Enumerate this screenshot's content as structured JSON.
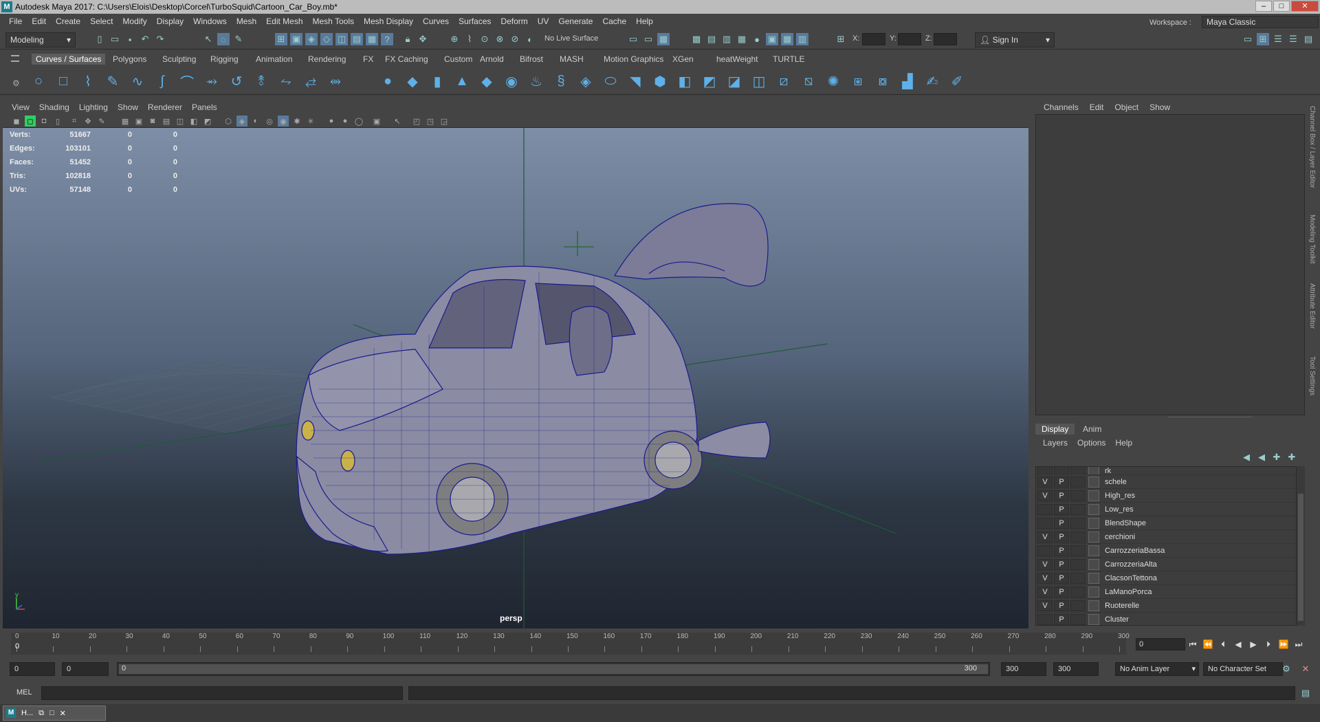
{
  "window": {
    "title": "Autodesk Maya 2017: C:\\Users\\Elois\\Desktop\\Corcel\\TurboSquid\\Cartoon_Car_Boy.mb*"
  },
  "menubar": [
    "File",
    "Edit",
    "Create",
    "Select",
    "Modify",
    "Display",
    "Windows",
    "Mesh",
    "Edit Mesh",
    "Mesh Tools",
    "Mesh Display",
    "Curves",
    "Surfaces",
    "Deform",
    "UV",
    "Generate",
    "Cache",
    "Help"
  ],
  "statusline": {
    "mode": "Modeling",
    "live_surface": "No Live Surface",
    "x_label": "X:",
    "y_label": "Y:",
    "z_label": "Z:",
    "sign_in": "Sign In",
    "workspace_label": "Workspace :",
    "workspace_value": "Maya Classic"
  },
  "shelf": {
    "tabs": [
      "Curves / Surfaces",
      "Polygons",
      "Sculpting",
      "Rigging",
      "Animation",
      "Rendering",
      "FX",
      "FX Caching",
      "Custom",
      "Arnold",
      "Bifrost",
      "MASH",
      "Motion Graphics",
      "XGen",
      "heatWeight",
      "TURTLE"
    ],
    "active_tab": "Curves / Surfaces"
  },
  "viewport": {
    "menu": [
      "View",
      "Shading",
      "Lighting",
      "Show",
      "Renderer",
      "Panels"
    ],
    "camera": "persp",
    "axis_y": "y",
    "hud": [
      [
        "Verts:",
        "51667",
        "0",
        "0"
      ],
      [
        "Edges:",
        "103101",
        "0",
        "0"
      ],
      [
        "Faces:",
        "51452",
        "0",
        "0"
      ],
      [
        "Tris:",
        "102818",
        "0",
        "0"
      ],
      [
        "UVs:",
        "57148",
        "0",
        "0"
      ]
    ]
  },
  "channel_box": {
    "menu": [
      "Channels",
      "Edit",
      "Object",
      "Show"
    ],
    "side_tabs": [
      "Channel Box / Layer Editor",
      "Modeling Toolkit",
      "Attribute Editor",
      "Tool Settings"
    ]
  },
  "layer_editor": {
    "tabs": [
      "Display",
      "Anim"
    ],
    "menu": [
      "Layers",
      "Options",
      "Help"
    ],
    "layers": [
      {
        "v": "",
        "p": "",
        "name": "rk"
      },
      {
        "v": "V",
        "p": "P",
        "name": "schele"
      },
      {
        "v": "V",
        "p": "P",
        "name": "High_res"
      },
      {
        "v": "",
        "p": "P",
        "name": "Low_res"
      },
      {
        "v": "",
        "p": "P",
        "name": "BlendShape"
      },
      {
        "v": "V",
        "p": "P",
        "name": "cerchioni"
      },
      {
        "v": "",
        "p": "P",
        "name": "CarrozzeriaBassa"
      },
      {
        "v": "V",
        "p": "P",
        "name": "CarrozzeriaAlta"
      },
      {
        "v": "V",
        "p": "P",
        "name": "ClacsonTettona"
      },
      {
        "v": "V",
        "p": "P",
        "name": "LaManoPorca"
      },
      {
        "v": "V",
        "p": "P",
        "name": "Ruoterelle"
      },
      {
        "v": "",
        "p": "P",
        "name": "Cluster"
      }
    ]
  },
  "timeline": {
    "ticks": [
      "0",
      "10",
      "20",
      "30",
      "40",
      "50",
      "60",
      "70",
      "80",
      "90",
      "100",
      "110",
      "120",
      "130",
      "140",
      "150",
      "160",
      "170",
      "180",
      "190",
      "200",
      "210",
      "220",
      "230",
      "240",
      "250",
      "260",
      "270",
      "280",
      "290",
      "300"
    ],
    "current_frame": "0",
    "current_field": "0"
  },
  "range": {
    "start": "0",
    "inner_start": "0",
    "slider_start": "0",
    "slider_end": "300",
    "inner_end": "300",
    "end": "300",
    "anim_layer": "No Anim Layer",
    "char_set": "No Character Set"
  },
  "cmdline": {
    "label": "MEL"
  },
  "taskbar": {
    "task_label": "H..."
  }
}
